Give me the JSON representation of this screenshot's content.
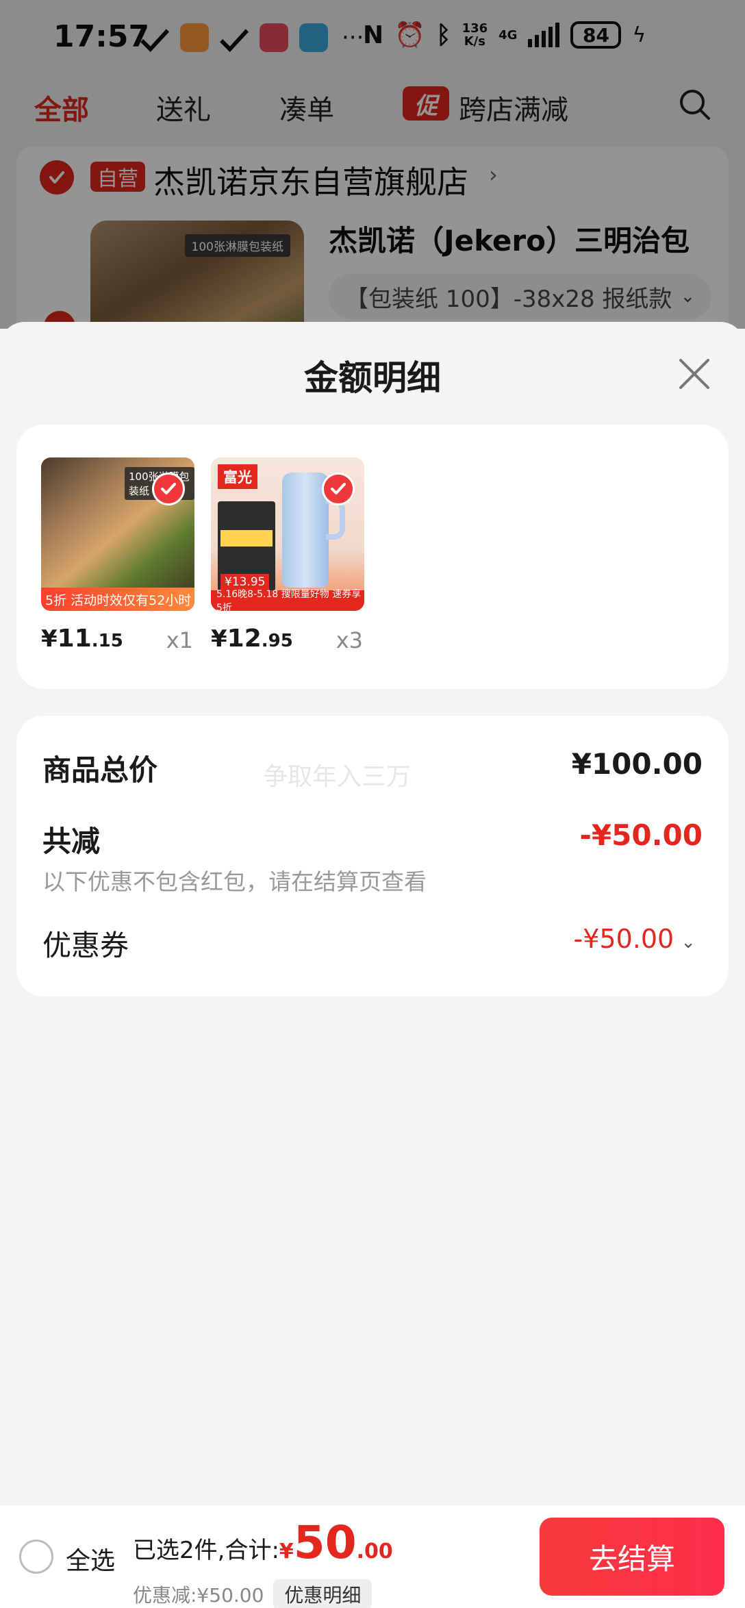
{
  "status_bar": {
    "time": "17:57",
    "more": "···",
    "nfc": "N",
    "net_speed_top": "136",
    "net_speed_bottom": "K/s",
    "network": "4G",
    "battery": "84"
  },
  "background": {
    "tabs": [
      {
        "label": "全部",
        "active": true
      },
      {
        "label": "送礼"
      },
      {
        "label": "凑单"
      },
      {
        "label": "跨店满减",
        "badge": "促"
      }
    ],
    "store": {
      "badge": "自营",
      "name": "杰凯诺京东自营旗舰店",
      "chevron": "›"
    },
    "product": {
      "title": "杰凯诺（Jekero）三明治包",
      "variant": "【包装纸 100】-38x28 报纸款",
      "variant_chevron": "⌄",
      "image_label": "100张淋膜包装纸"
    }
  },
  "sheet": {
    "title": "金额明细",
    "products": [
      {
        "price_symbol": "¥",
        "price_int": "11",
        "price_dec": ".15",
        "qty": "x1",
        "tag": "5折 活动时效仅有52小时",
        "image_label": "100张淋膜包装纸"
      },
      {
        "price_symbol": "¥",
        "price_int": "12",
        "price_dec": ".95",
        "qty": "x3",
        "brand": "富光",
        "price_chip": "¥13.95",
        "banner": "5.16晚8-5.18 搜限量好物 速券享5折"
      }
    ],
    "summary": {
      "total_label": "商品总价",
      "total_value": "¥100.00",
      "watermark": "争取年入三万",
      "discount_label": "共减",
      "discount_value": "-¥50.00",
      "discount_note": "以下优惠不包含红包，请在结算页查看",
      "coupon_label": "优惠券",
      "coupon_value": "-¥50.00",
      "coupon_chevron": "⌄"
    }
  },
  "bottom_bar": {
    "select_all": "全选",
    "selected_text": "已选2件,合计:",
    "total_symbol": "¥",
    "total_int": "50",
    "total_dec": ".00",
    "discount_text": "优惠减:¥50.00",
    "detail_button": "优惠明细",
    "checkout_button": "去结算"
  },
  "colors": {
    "accent_red": "#e3271f",
    "checkout_red": "#f53a3a",
    "background": "#f4f4f4"
  }
}
